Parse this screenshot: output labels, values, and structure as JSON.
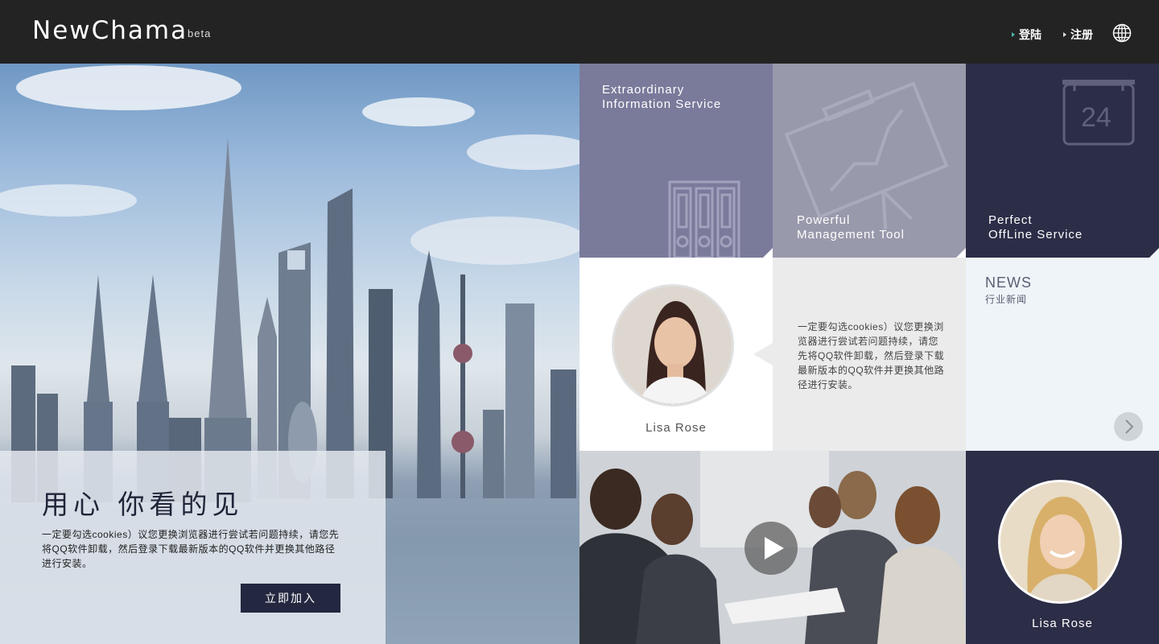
{
  "header": {
    "brand": "NewChama",
    "beta": "beta",
    "nav": [
      {
        "label": "登陆",
        "icon": "triangle-right-icon"
      },
      {
        "label": "注册",
        "icon": "triangle-right-icon"
      }
    ],
    "globe_icon": "globe-icon"
  },
  "hero": {
    "title": "用心  你看的见",
    "text": "一定要勾选cookies）议您更换浏览器进行尝试若问题持续，请您先将QQ软件卸载，然后登录下载最新版本的QQ软件并更换其他路径进行安装。",
    "button": "立即加入"
  },
  "tiles": {
    "info": {
      "line1": "Extraordinary",
      "line2": "Information Service",
      "icon": "binders-icon"
    },
    "management": {
      "line1": "Powerful",
      "line2": "Management Tool",
      "icon": "chart-board-icon"
    },
    "offline": {
      "line1": "Perfect",
      "line2": "OffLine Service",
      "icon": "calendar-icon",
      "calendar_day": "24"
    },
    "profile": {
      "name": "Lisa Rose"
    },
    "quote": {
      "text": "一定要勾选cookies）议您更换浏览器进行尝试若问题持续，请您先将QQ软件卸载，然后登录下载最新版本的QQ软件并更换其他路径进行安装。"
    },
    "news": {
      "title": "NEWS",
      "subtitle": "行业新闻",
      "icon": "chevron-right-icon"
    },
    "video": {
      "icon": "play-icon"
    },
    "profile2": {
      "name": "Lisa Rose"
    }
  },
  "colors": {
    "header_bg": "#232323",
    "tile_purple": "#7a7a9b",
    "tile_grey": "#9899ab",
    "tile_navy": "#2c2d47",
    "button_navy": "#232840"
  }
}
